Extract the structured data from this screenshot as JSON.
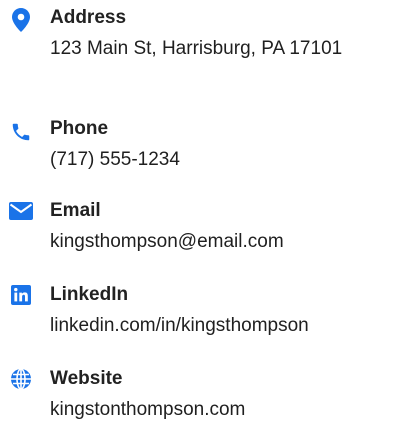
{
  "theme": {
    "icon_color": "#1a73e8"
  },
  "contact": {
    "items": [
      {
        "icon": "map-pin-icon",
        "label": "Address",
        "value": "123 Main St, Harrisburg, PA 17101"
      },
      {
        "icon": "phone-icon",
        "label": "Phone",
        "value": "(717) 555-1234"
      },
      {
        "icon": "envelope-icon",
        "label": "Email",
        "value": "kingsthompson@email.com"
      },
      {
        "icon": "linkedin-icon",
        "label": "LinkedIn",
        "value": "linkedin.com/in/kingsthompson"
      },
      {
        "icon": "globe-icon",
        "label": "Website",
        "value": "kingstonthompson.com"
      }
    ]
  }
}
